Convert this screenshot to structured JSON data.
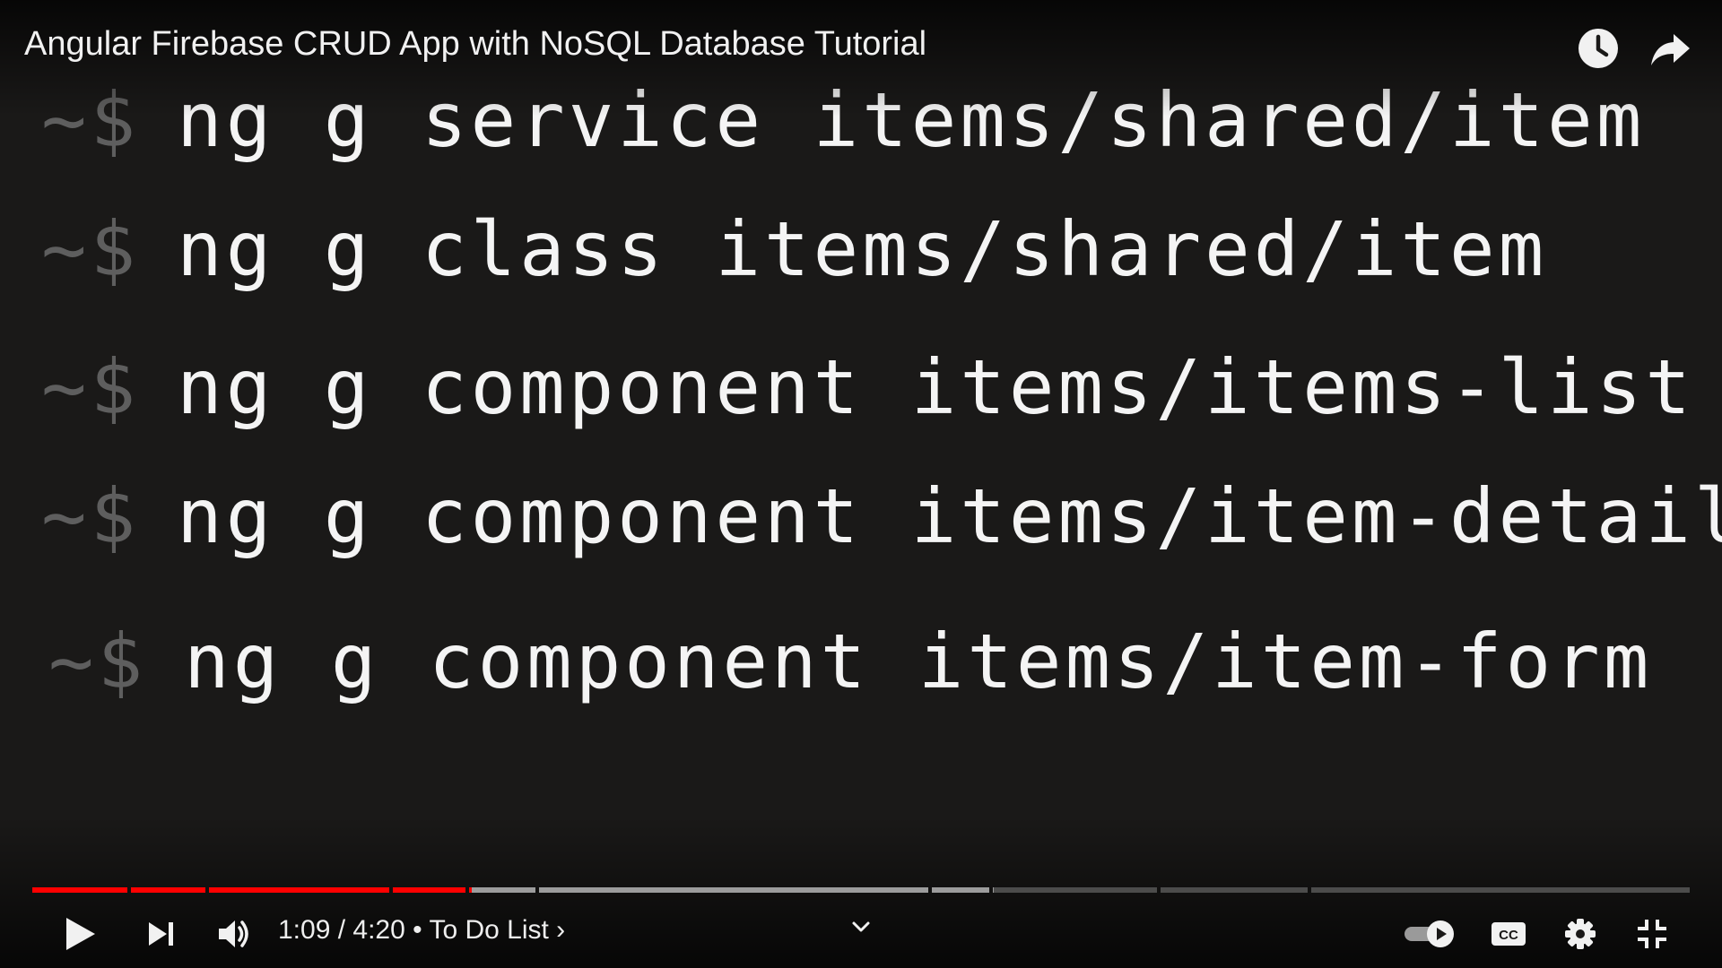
{
  "video": {
    "title": "Angular Firebase CRUD App with NoSQL Database Tutorial"
  },
  "top_actions": {
    "watch_later_icon": "clock-icon",
    "share_icon": "share-arrow-icon"
  },
  "frame": {
    "lines": [
      {
        "prompt": "~$",
        "command": "ng g service items/shared/item"
      },
      {
        "prompt": "~$",
        "command": "ng g class items/shared/item"
      },
      {
        "prompt": "~$",
        "command": "ng g component items/items-list"
      },
      {
        "prompt": "~$",
        "command": "ng g component items/item-detail"
      },
      {
        "prompt": "~$",
        "command": "ng g component items/item-form"
      }
    ]
  },
  "player": {
    "current_time": "1:09",
    "duration": "4:20",
    "time_separator": " / ",
    "chapter_separator": " • ",
    "chapter_title": "To Do List",
    "chapter_arrow": "›",
    "progress_fraction": 0.265,
    "colors": {
      "played": "#ff0000",
      "background": "#1a1918"
    },
    "icons": {
      "play": "play-icon",
      "next": "next-icon",
      "volume": "volume-icon",
      "chevron": "chevron-down-icon",
      "autoplay": "autoplay-toggle-icon",
      "captions": "cc-icon",
      "settings": "gear-icon",
      "exit_fullscreen": "exit-fullscreen-icon"
    }
  }
}
